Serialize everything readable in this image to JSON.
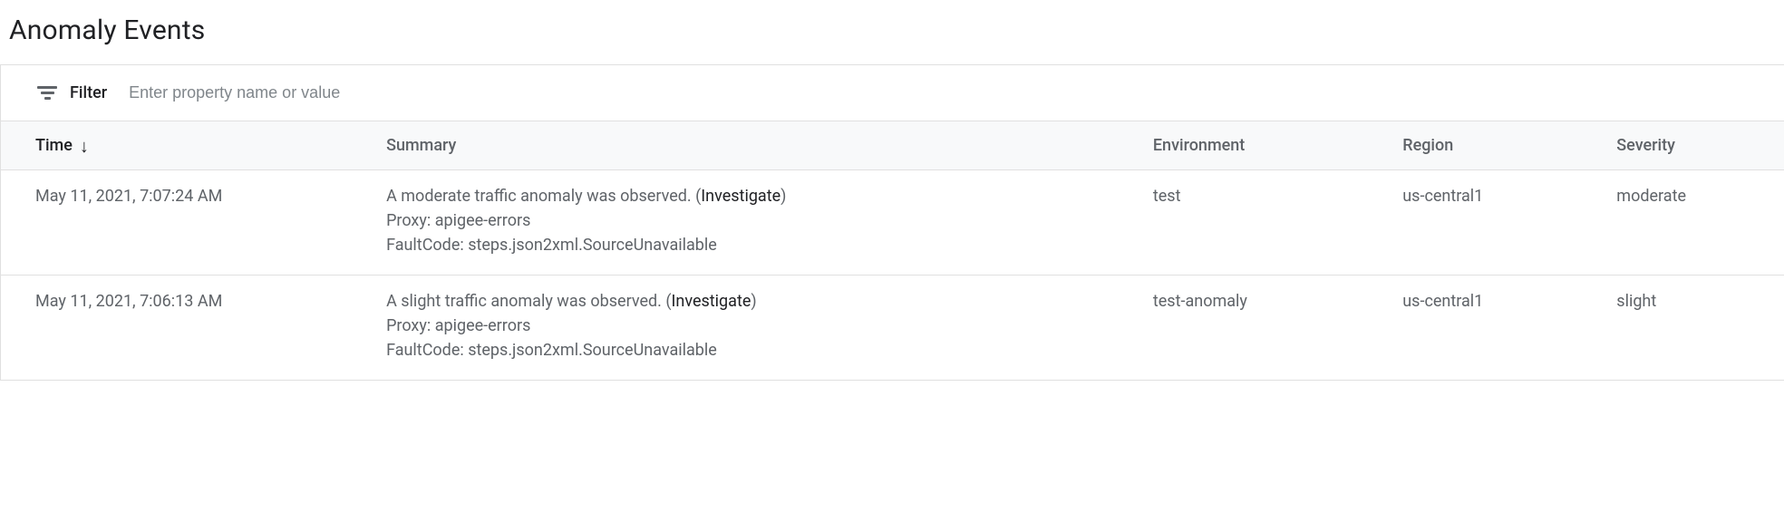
{
  "title": "Anomaly Events",
  "filter": {
    "label": "Filter",
    "placeholder": "Enter property name or value"
  },
  "columns": {
    "time": "Time",
    "summary": "Summary",
    "environment": "Environment",
    "region": "Region",
    "severity": "Severity"
  },
  "rows": [
    {
      "time": "May 11, 2021, 7:07:24 AM",
      "summary_text": "A moderate traffic anomaly was observed. (",
      "investigate": "Investigate",
      "summary_close": ")",
      "proxy_line": "Proxy: apigee-errors",
      "fault_line": "FaultCode: steps.json2xml.SourceUnavailable",
      "environment": "test",
      "region": "us-central1",
      "severity": "moderate"
    },
    {
      "time": "May 11, 2021, 7:06:13 AM",
      "summary_text": "A slight traffic anomaly was observed. (",
      "investigate": "Investigate",
      "summary_close": ")",
      "proxy_line": "Proxy: apigee-errors",
      "fault_line": "FaultCode: steps.json2xml.SourceUnavailable",
      "environment": "test-anomaly",
      "region": "us-central1",
      "severity": "slight"
    }
  ]
}
